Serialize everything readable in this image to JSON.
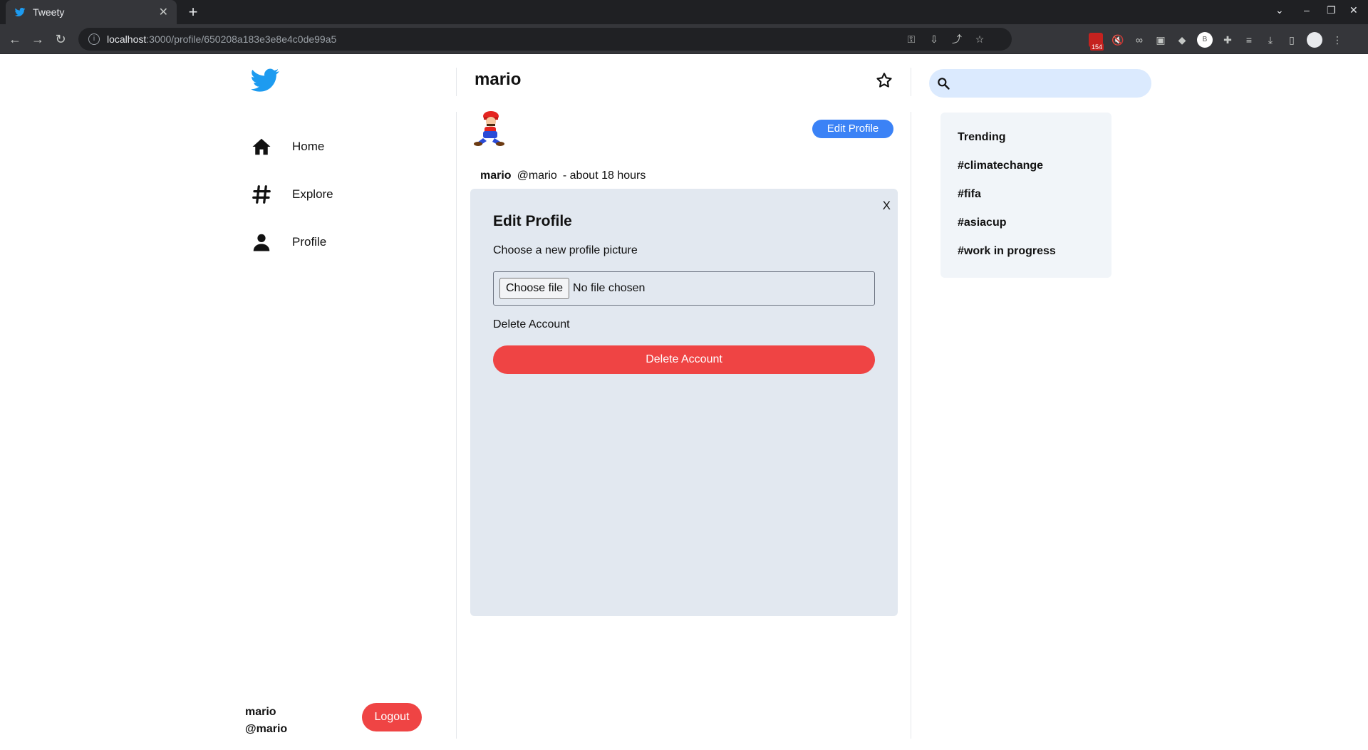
{
  "browser": {
    "tab_title": "Tweety",
    "url_host": "localhost",
    "url_path": ":3000/profile/650208a183e3e8e4c0de99a5",
    "extension_badge": "154",
    "profile_initial": "B"
  },
  "sidebar": {
    "items": [
      {
        "label": "Home"
      },
      {
        "label": "Explore"
      },
      {
        "label": "Profile"
      }
    ],
    "user_name": "mario",
    "user_handle": "@mario",
    "logout_label": "Logout"
  },
  "profile": {
    "header_name": "mario",
    "edit_button_label": "Edit Profile",
    "post_name": "mario",
    "post_handle": "@mario",
    "post_time": "- about 18 hours"
  },
  "modal": {
    "close_label": "X",
    "title": "Edit Profile",
    "subtitle": "Choose a new profile picture",
    "choose_file_label": "Choose file",
    "no_file_label": "No file chosen",
    "delete_section_label": "Delete Account",
    "delete_button_label": "Delete Account"
  },
  "search": {
    "placeholder": ""
  },
  "trending": {
    "title": "Trending",
    "items": [
      "#climatechange",
      "#fifa",
      "#asiacup",
      "#work in progress"
    ]
  },
  "colors": {
    "accent_blue": "#3b82f6",
    "danger_red": "#ef4444",
    "modal_bg": "#e2e8f0",
    "search_bg": "#dbeafe"
  }
}
